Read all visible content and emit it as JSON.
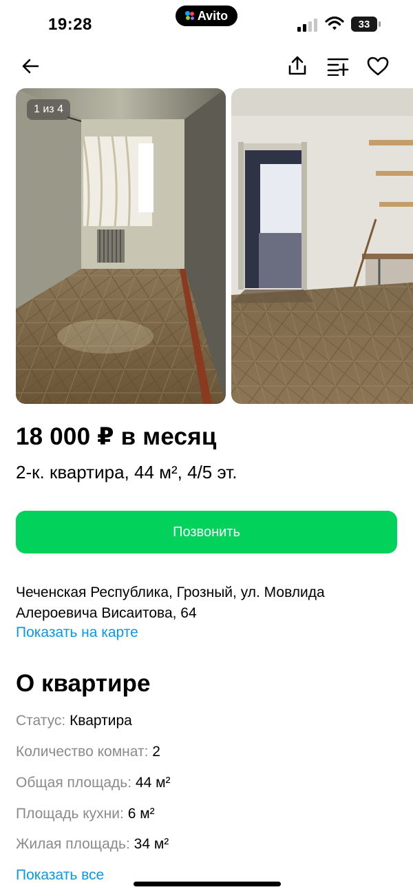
{
  "status_bar": {
    "time": "19:28",
    "app_pill": "Avito",
    "battery": "33"
  },
  "gallery": {
    "counter": "1 из 4"
  },
  "listing": {
    "price": "18 000 ₽ в месяц",
    "subtitle": "2-к. квартира, 44 м², 4/5 эт."
  },
  "call_button": "Позвонить",
  "address": {
    "line1": "Чеченская Республика, Грозный, ул. Мовлида",
    "line2": "Алероевича Висаитова, 64",
    "map_link": "Показать на карте"
  },
  "about": {
    "title": "О квартире",
    "params": [
      {
        "key": "Статус:",
        "value": "Квартира"
      },
      {
        "key": "Количество комнат:",
        "value": "2"
      },
      {
        "key": "Общая площадь:",
        "value": "44 м²"
      },
      {
        "key": "Площадь кухни:",
        "value": "6 м²"
      },
      {
        "key": "Жилая площадь:",
        "value": "34 м²"
      }
    ],
    "show_all": "Показать все"
  },
  "colors": {
    "accent_green": "#02d15c",
    "link_blue": "#0a97e8",
    "muted_text": "#8a8a8a"
  },
  "icons": [
    "back-arrow-icon",
    "share-icon",
    "compare-icon",
    "favorite-heart-icon",
    "signal-icon",
    "wifi-icon",
    "battery-icon"
  ]
}
